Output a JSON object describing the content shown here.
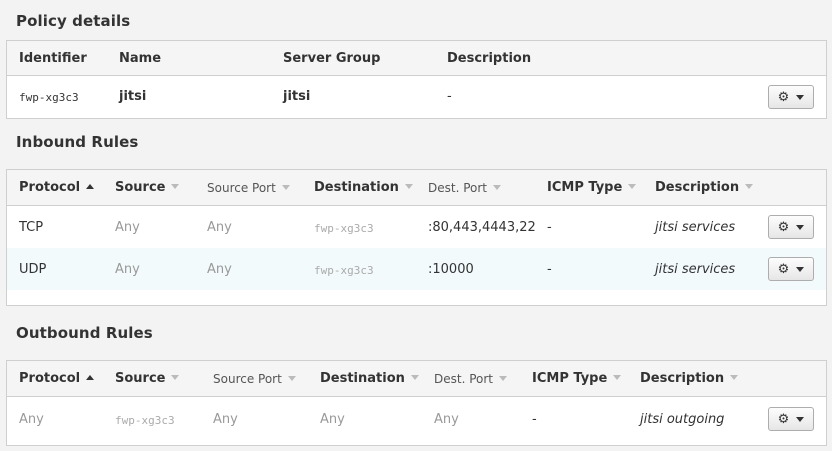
{
  "policy": {
    "title": "Policy details",
    "columns": [
      "Identifier",
      "Name",
      "Server Group",
      "Description"
    ],
    "row": {
      "identifier": "fwp-xg3c3",
      "name": "jitsi",
      "server_group": "jitsi",
      "description": "-"
    }
  },
  "inbound": {
    "title": "Inbound Rules",
    "columns": [
      "Protocol",
      "Source",
      "Source Port",
      "Destination",
      "Dest. Port",
      "ICMP Type",
      "Description"
    ],
    "rows": [
      {
        "protocol": "TCP",
        "source": "Any",
        "source_port": "Any",
        "destination": "fwp-xg3c3",
        "dest_port": ":80,443,4443,22",
        "icmp_type": "-",
        "description": "jitsi services"
      },
      {
        "protocol": "UDP",
        "source": "Any",
        "source_port": "Any",
        "destination": "fwp-xg3c3",
        "dest_port": ":10000",
        "icmp_type": "-",
        "description": "jitsi services"
      }
    ]
  },
  "outbound": {
    "title": "Outbound Rules",
    "columns": [
      "Protocol",
      "Source",
      "Source Port",
      "Destination",
      "Dest. Port",
      "ICMP Type",
      "Description"
    ],
    "rows": [
      {
        "protocol": "Any",
        "source": "fwp-xg3c3",
        "source_port": "Any",
        "destination": "Any",
        "dest_port": "Any",
        "icmp_type": "-",
        "description": "jitsi outgoing"
      }
    ]
  },
  "icons": {
    "action": "gear-icon",
    "dropdown": "caret-down-icon",
    "sort_asc": "sort-asc-icon",
    "sort": "sort-icon"
  }
}
